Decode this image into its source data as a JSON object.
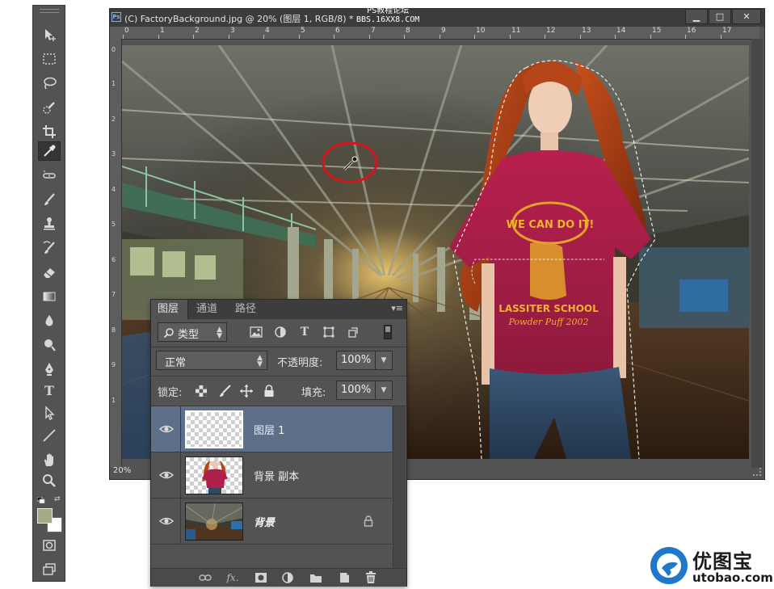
{
  "document": {
    "title": "(C) FactoryBackground.jpg @ 20% (图层 1, RGB/8) *",
    "watermark_top_line1": "PS教程论坛",
    "watermark_top_line2": "BBS.16XX8.COM",
    "zoom": "20%",
    "ruler_top_labels": [
      "0",
      "1",
      "2",
      "3",
      "4",
      "5",
      "6",
      "7",
      "8",
      "9",
      "10",
      "11",
      "12",
      "13",
      "14",
      "15",
      "16",
      "17"
    ],
    "ruler_left_labels": [
      "0",
      "1",
      "2",
      "3",
      "4",
      "5",
      "6",
      "7",
      "8",
      "9",
      "1"
    ],
    "window_buttons": {
      "minimize": "▁",
      "maximize": "□",
      "close": "✕"
    },
    "shirt_text_1": "WE CAN DO IT!",
    "shirt_text_2": "LASSITER SCHOOL",
    "shirt_text_3": "Powder Puff 2002"
  },
  "toolbar": {
    "tools": [
      "move-tool",
      "marquee-tool",
      "lasso-tool",
      "quick-selection-tool",
      "crop-tool",
      "eyedropper-tool",
      "spot-healing-tool",
      "brush-tool",
      "clone-stamp-tool",
      "history-brush-tool",
      "eraser-tool",
      "gradient-tool",
      "blur-tool",
      "dodge-tool",
      "pen-tool",
      "type-tool",
      "path-selection-tool",
      "line-tool",
      "hand-tool",
      "zoom-tool"
    ],
    "active_tool": "eyedropper-tool",
    "type_tool_glyph": "T",
    "foreground_color": "#a3ab86",
    "background_color": "#ffffff"
  },
  "layers_panel": {
    "tabs": [
      "图层",
      "通道",
      "路径"
    ],
    "active_tab": "图层",
    "menu_icon": "▾≡",
    "filter_kind": "类型",
    "filter_text_icon": "T",
    "blend_mode": "正常",
    "opacity_label": "不透明度:",
    "opacity_value": "100%",
    "lock_label": "锁定:",
    "fill_label": "填充:",
    "fill_value": "100%",
    "layers": [
      {
        "name": "图层 1",
        "selected": true,
        "visible": true,
        "locked": false
      },
      {
        "name": "背景 副本",
        "selected": false,
        "visible": true,
        "locked": false
      },
      {
        "name": "背景",
        "selected": false,
        "visible": true,
        "locked": true
      }
    ],
    "footer_icons": [
      "link-icon",
      "fx-icon",
      "mask-icon",
      "adjustment-icon",
      "folder-icon",
      "new-layer-icon",
      "trash-icon"
    ],
    "fx_label": "fx."
  },
  "logo": {
    "text": "优图宝",
    "url": "utobao.com"
  },
  "colors": {
    "panel_bg": "#535353",
    "selected_layer": "#5e7089",
    "ellipse_highlight": "#d9141b",
    "logo_blue": "#1f78c8"
  }
}
